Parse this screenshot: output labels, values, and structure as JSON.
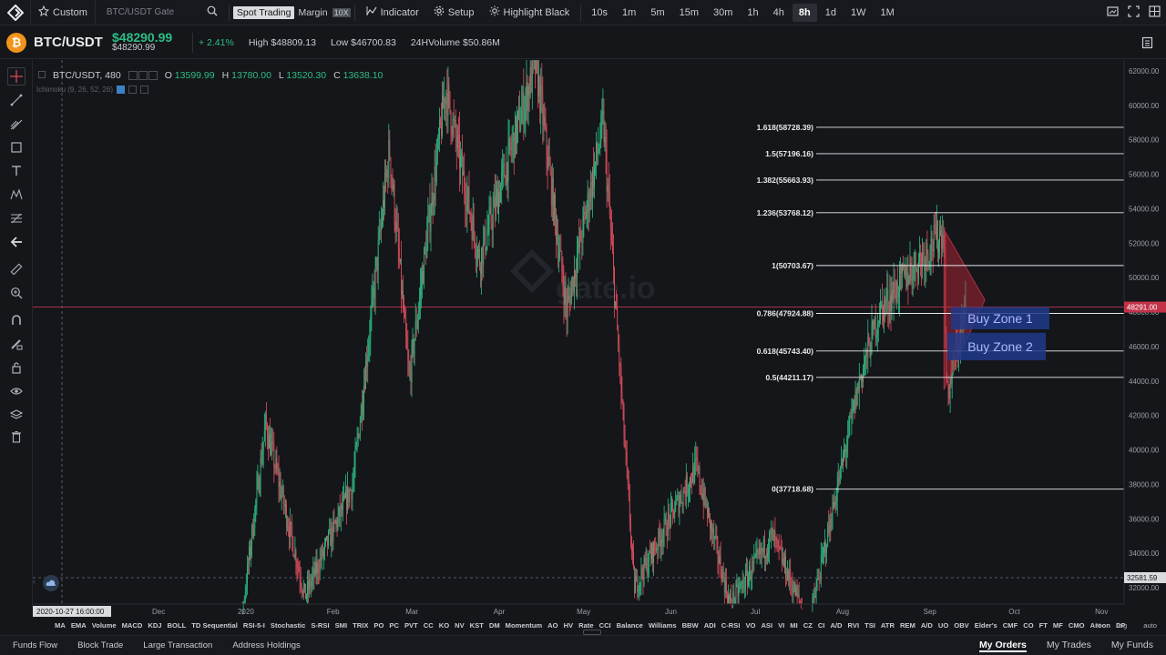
{
  "toolbar": {
    "chart_style_label": "Custom",
    "symbol_search_placeholder": "BTC/USDT Gate",
    "spot_label": "Spot Trading",
    "margin_label": "Margin",
    "margin_leverage": "10X",
    "indicator_label": "Indicator",
    "setup_label": "Setup",
    "highlight_label": "Highlight Black",
    "timeframes": [
      "10s",
      "1m",
      "5m",
      "15m",
      "30m",
      "1h",
      "4h",
      "8h",
      "1d",
      "1W",
      "1M"
    ],
    "active_timeframe": "8h"
  },
  "ticker": {
    "coin_glyph": "₿",
    "pair": "BTC/USDT",
    "price": "$48290.99",
    "price_sub": "$48290.99",
    "change": "+ 2.41%",
    "high": "High $48809.13",
    "low": "Low $46700.83",
    "volume": "24HVolume $50.86M"
  },
  "chart": {
    "symbol_label": "BTC/USDT, 480",
    "open_label": "O",
    "open": "13599.99",
    "high_label": "H",
    "high": "13780.00",
    "low_label": "L",
    "low": "13520.30",
    "close_label": "C",
    "close": "13638.10",
    "indicator_legend": "Ichimoku (9, 26, 52, 26)",
    "watermark": "gate.io",
    "current_price_tag": "48291.00",
    "crosshair_price_tag": "32581.59",
    "crosshair_date_tag": "2020-10-27 16:00:00",
    "candle_up_color": "#2ebd85",
    "candle_down_color": "#e04f5f",
    "fib_color": "#e8eaed",
    "zone_color": "#1f3a8a",
    "zone_text_color": "#aeb8ff"
  },
  "chart_data": {
    "type": "candlestick",
    "symbol": "BTC/USDT",
    "interval": "8h",
    "ylim": [
      31200,
      62500
    ],
    "y_ticks": [
      "62000.00",
      "60000.00",
      "58000.00",
      "56000.00",
      "54000.00",
      "52000.00",
      "50000.00",
      "48000.00",
      "46000.00",
      "44000.00",
      "42000.00",
      "40000.00",
      "38000.00",
      "36000.00",
      "34000.00",
      "32000.00"
    ],
    "x_ticks": [
      "Dec",
      "2020",
      "Feb",
      "Mar",
      "Apr",
      "May",
      "Jun",
      "Jul",
      "Aug",
      "Sep",
      "Oct",
      "Nov"
    ],
    "approx_price_path": [
      {
        "date": "2020-12-25",
        "price": 23000
      },
      {
        "date": "2021-01-08",
        "price": 41500
      },
      {
        "date": "2021-01-22",
        "price": 31500
      },
      {
        "date": "2021-02-08",
        "price": 38000
      },
      {
        "date": "2021-02-21",
        "price": 57500
      },
      {
        "date": "2021-02-28",
        "price": 44000
      },
      {
        "date": "2021-03-13",
        "price": 61000
      },
      {
        "date": "2021-03-25",
        "price": 51000
      },
      {
        "date": "2021-04-14",
        "price": 62500
      },
      {
        "date": "2021-04-25",
        "price": 48000
      },
      {
        "date": "2021-05-08",
        "price": 59000
      },
      {
        "date": "2021-05-19",
        "price": 32000
      },
      {
        "date": "2021-06-10",
        "price": 39000
      },
      {
        "date": "2021-06-22",
        "price": 31000
      },
      {
        "date": "2021-07-07",
        "price": 35000
      },
      {
        "date": "2021-07-20",
        "price": 29800
      },
      {
        "date": "2021-08-07",
        "price": 44000
      },
      {
        "date": "2021-08-14",
        "price": 48000
      },
      {
        "date": "2021-08-23",
        "price": 50000
      },
      {
        "date": "2021-09-06",
        "price": 52800
      },
      {
        "date": "2021-09-07",
        "price": 43000
      },
      {
        "date": "2021-09-14",
        "price": 48290
      }
    ],
    "fibonacci": [
      {
        "label": "1.618(58728.39)",
        "value": 58728.39
      },
      {
        "label": "1.5(57196.16)",
        "value": 57196.16
      },
      {
        "label": "1.382(55663.93)",
        "value": 55663.93
      },
      {
        "label": "1.236(53768.12)",
        "value": 53768.12
      },
      {
        "label": "1(50703.67)",
        "value": 50703.67
      },
      {
        "label": "0.786(47924.88)",
        "value": 47924.88
      },
      {
        "label": "0.618(45743.40)",
        "value": 45743.4
      },
      {
        "label": "0.5(44211.17)",
        "value": 44211.17
      },
      {
        "label": "0(37718.68)",
        "value": 37718.68
      }
    ],
    "zones": [
      {
        "label": "Buy Zone 1",
        "top": 48290,
        "bottom": 47000
      },
      {
        "label": "Buy Zone 2",
        "top": 46800,
        "bottom": 45200
      }
    ],
    "current_price": 48291.0,
    "crosshair_price": 32581.59
  },
  "indicators": [
    "MA",
    "EMA",
    "Volume",
    "MACD",
    "KDJ",
    "BOLL",
    "TD Sequential",
    "RSI-5-I",
    "Stochastic",
    "S-RSI",
    "SMI",
    "TRIX",
    "PO",
    "PC",
    "PVT",
    "CC",
    "KO",
    "NV",
    "KST",
    "DM",
    "Momentum",
    "AO",
    "HV",
    "Rate",
    "CCI",
    "Balance",
    "Williams",
    "BBW",
    "ADI",
    "C-RSI",
    "VO",
    "ASI",
    "VI",
    "MI",
    "CZ",
    "CI",
    "A/D",
    "RVI",
    "TSI",
    "ATR",
    "REM",
    "A/D",
    "UO",
    "OBV",
    "Elder's",
    "CMF",
    "CO",
    "FT",
    "MF",
    "CMO",
    "Aroon",
    "DP"
  ],
  "indicator_right": [
    "%",
    "log",
    "auto"
  ],
  "bottom": {
    "left_tabs": [
      "Funds Flow",
      "Block Trade",
      "Large Transaction",
      "Address Holdings"
    ],
    "right_tabs": [
      "My Orders",
      "My Trades",
      "My Funds"
    ]
  }
}
